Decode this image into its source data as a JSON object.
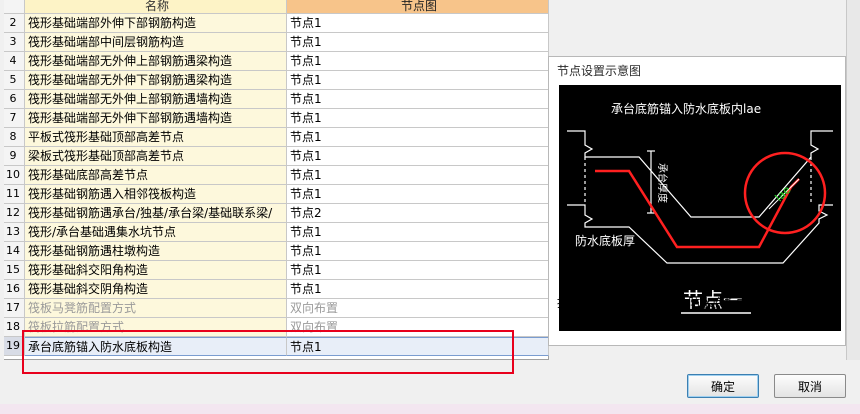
{
  "table": {
    "headers": {
      "name": "名称",
      "node": "节点图"
    },
    "rows": [
      {
        "idx": "2",
        "name": "筏形基础端部外伸下部钢筋构造",
        "node": "节点1"
      },
      {
        "idx": "3",
        "name": "筏形基础端部中间层钢筋构造",
        "node": "节点1"
      },
      {
        "idx": "4",
        "name": "筏形基础端部无外伸上部钢筋遇梁构造",
        "node": "节点1"
      },
      {
        "idx": "5",
        "name": "筏形基础端部无外伸下部钢筋遇梁构造",
        "node": "节点1"
      },
      {
        "idx": "6",
        "name": "筏形基础端部无外伸上部钢筋遇墙构造",
        "node": "节点1"
      },
      {
        "idx": "7",
        "name": "筏形基础端部无外伸下部钢筋遇墙构造",
        "node": "节点1"
      },
      {
        "idx": "8",
        "name": "平板式筏形基础顶部高差节点",
        "node": "节点1"
      },
      {
        "idx": "9",
        "name": "梁板式筏形基础顶部高差节点",
        "node": "节点1"
      },
      {
        "idx": "10",
        "name": "筏形基础底部高差节点",
        "node": "节点1"
      },
      {
        "idx": "11",
        "name": "筏形基础钢筋遇入相邻筏板构造",
        "node": "节点1"
      },
      {
        "idx": "12",
        "name": "筏形基础钢筋遇承台/独基/承台梁/基础联系梁/",
        "node": "节点2"
      },
      {
        "idx": "13",
        "name": "筏形/承台基础遇集水坑节点",
        "node": "节点1"
      },
      {
        "idx": "14",
        "name": "筏形基础钢筋遇柱墩构造",
        "node": "节点1"
      },
      {
        "idx": "15",
        "name": "筏形基础斜交阳角构造",
        "node": "节点1"
      },
      {
        "idx": "16",
        "name": "筏形基础斜交阴角构造",
        "node": "节点1"
      },
      {
        "idx": "17",
        "name": "筏板马凳筋配置方式",
        "node": "双向布置"
      },
      {
        "idx": "18",
        "name": "筏板拉筋配置方式",
        "node": "双向布置"
      },
      {
        "idx": "19",
        "name": "承台底筋锚入防水底板构造",
        "node": "节点1"
      }
    ]
  },
  "panel": {
    "title": "节点设置示意图",
    "diagram": {
      "top_label": "承台底筋锚入防水底板内lae",
      "side_label": "承台厚度",
      "left_label": "防水底板厚",
      "lae_label": "lae",
      "node_title": "节点一"
    },
    "hint_label": "提示信息:",
    "hint_text": "承台底筋锚入防水底板内lae"
  },
  "buttons": {
    "ok": "确定",
    "cancel": "取消"
  },
  "colors": {
    "highlight": "#e8001c",
    "diagram_bg": "#000000",
    "rebar": "#ff2020",
    "lae_text": "#22dd22"
  }
}
